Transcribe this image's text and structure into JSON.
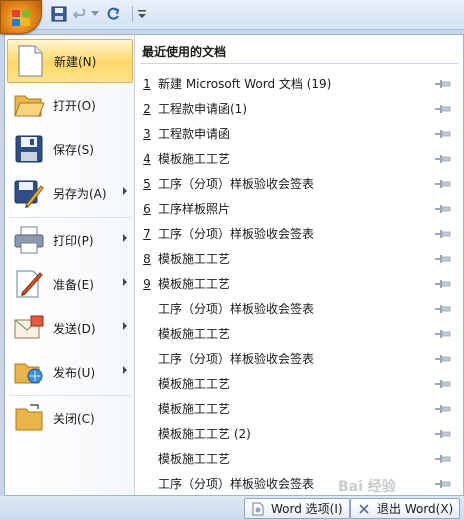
{
  "left_menu": {
    "items": [
      {
        "label": "新建(N)",
        "key": "new",
        "arrow": false
      },
      {
        "label": "打开(O)",
        "key": "open",
        "arrow": false
      },
      {
        "label": "保存(S)",
        "key": "save",
        "arrow": false
      },
      {
        "label": "另存为(A)",
        "key": "saveas",
        "arrow": true
      },
      {
        "label": "打印(P)",
        "key": "print",
        "arrow": true
      },
      {
        "label": "准备(E)",
        "key": "prepare",
        "arrow": true
      },
      {
        "label": "发送(D)",
        "key": "send",
        "arrow": true
      },
      {
        "label": "发布(U)",
        "key": "publish",
        "arrow": true
      },
      {
        "label": "关闭(C)",
        "key": "close",
        "arrow": false
      }
    ],
    "active_item": "新建(N)"
  },
  "recent": {
    "title": "最近使用的文档",
    "items": [
      {
        "num": "1",
        "name": "新建 Microsoft Word 文档 (19)"
      },
      {
        "num": "2",
        "name": "工程款申请函(1)"
      },
      {
        "num": "3",
        "name": "工程款申请函"
      },
      {
        "num": "4",
        "name": "模板施工工艺"
      },
      {
        "num": "5",
        "name": "工序（分项）样板验收会签表"
      },
      {
        "num": "6",
        "name": "工序样板照片"
      },
      {
        "num": "7",
        "name": "工序（分项）样板验收会签表"
      },
      {
        "num": "8",
        "name": "模板施工工艺"
      },
      {
        "num": "9",
        "name": "模板施工工艺"
      },
      {
        "num": "",
        "name": "工序（分项）样板验收会签表"
      },
      {
        "num": "",
        "name": "模板施工工艺"
      },
      {
        "num": "",
        "name": "工序（分项）样板验收会签表"
      },
      {
        "num": "",
        "name": "模板施工工艺"
      },
      {
        "num": "",
        "name": "模板施工工艺"
      },
      {
        "num": "",
        "name": "模板施工工艺 (2)"
      },
      {
        "num": "",
        "name": "模板施工工艺"
      },
      {
        "num": "",
        "name": "工序（分项）样板验收会签表"
      }
    ]
  },
  "bottom": {
    "options_label": "Word 选项(I)",
    "exit_label": "退出 Word(X)"
  },
  "watermark": "Bai 经验",
  "colors": {
    "active_highlight": "#ffd769",
    "office_button": "#e8891a",
    "frame_blue": "#c7d6ea"
  }
}
